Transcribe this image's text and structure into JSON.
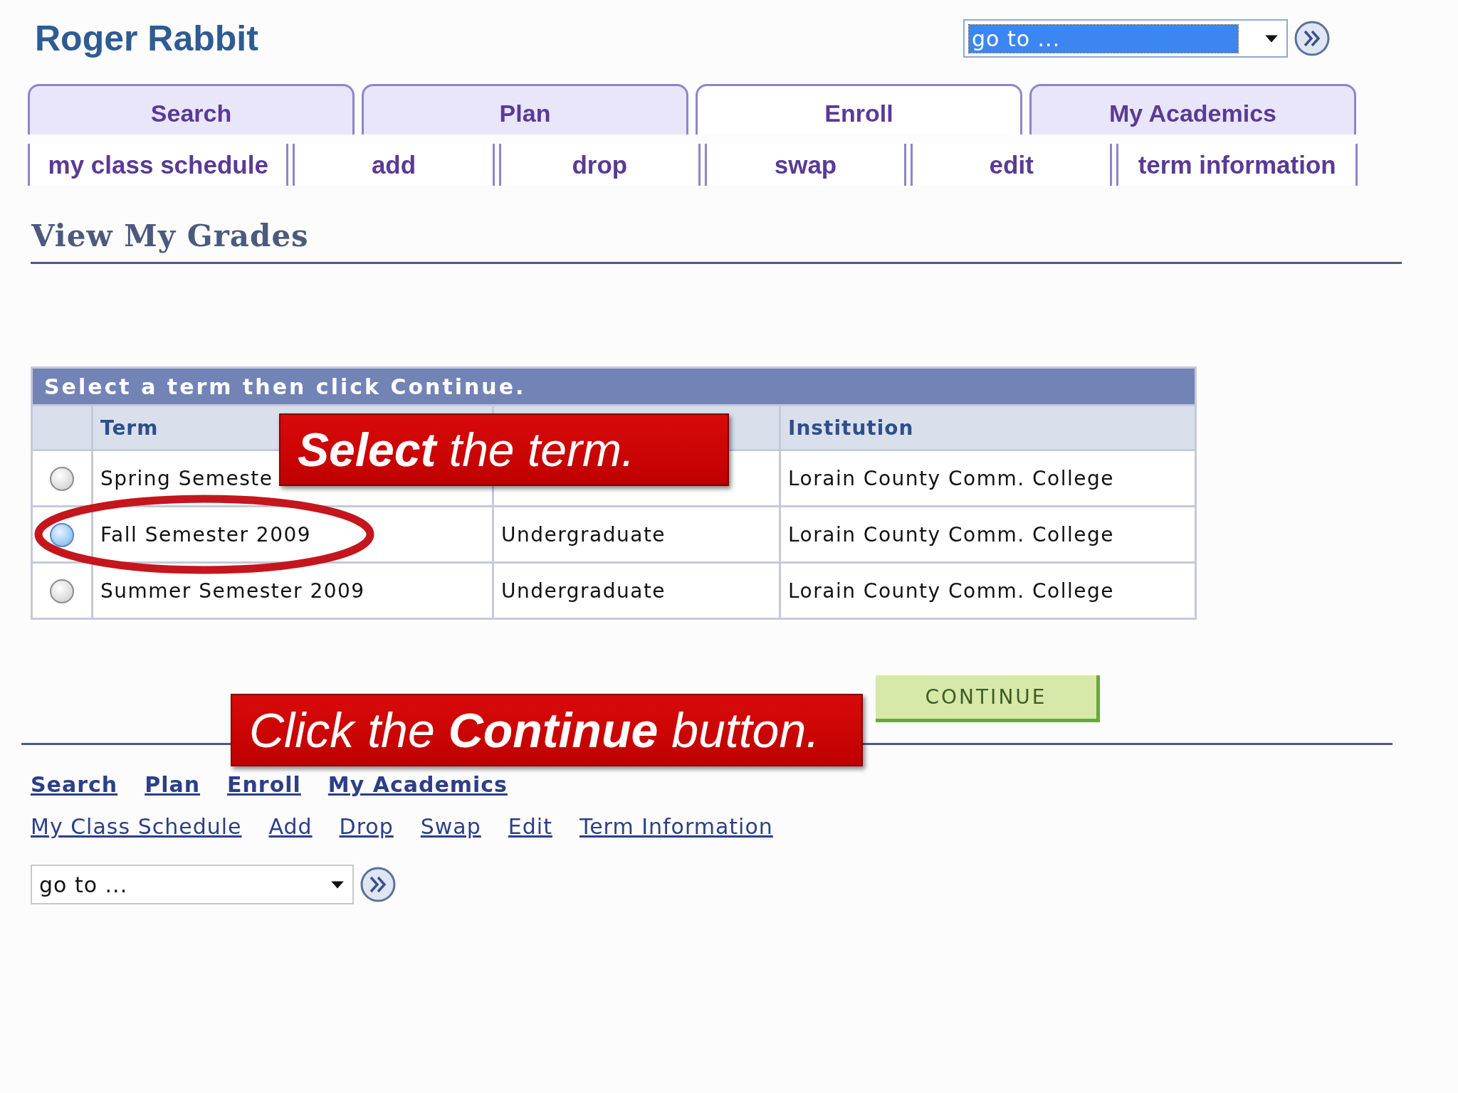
{
  "header": {
    "title": "Roger Rabbit",
    "goto": {
      "value": "go to ...",
      "highlighted": true
    }
  },
  "tabs": [
    {
      "label": "Search",
      "selected": false
    },
    {
      "label": "Plan",
      "selected": false
    },
    {
      "label": "Enroll",
      "selected": true
    },
    {
      "label": "My Academics",
      "selected": false
    }
  ],
  "subtabs": [
    "my class schedule",
    "add",
    "drop",
    "swap",
    "edit",
    "term information"
  ],
  "page_title": "View My Grades",
  "term_table": {
    "caption": "Select a term then click Continue.",
    "columns": [
      "Term",
      null,
      "Institution"
    ],
    "rows": [
      {
        "selected": false,
        "term": "Spring Semeste",
        "institution": "Lorain County Comm. College"
      },
      {
        "selected": true,
        "term": "Fall Semester 2009",
        "career": "Undergraduate",
        "institution": "Lorain County Comm. College"
      },
      {
        "selected": false,
        "term": "Summer Semester 2009",
        "career": "Undergraduate",
        "institution": "Lorain County Comm. College"
      }
    ]
  },
  "continue_button": "CONTINUE",
  "callouts": [
    "**Select** the term.",
    "Click the **Continue** button."
  ],
  "footer": {
    "primary_links": [
      "Search",
      "Plan",
      "Enroll",
      "My Academics"
    ],
    "secondary_links": [
      "My Class Schedule",
      "Add",
      "Drop",
      "Swap",
      "Edit",
      "Term Information"
    ],
    "goto": {
      "value": "go to ...",
      "highlighted": false
    }
  }
}
